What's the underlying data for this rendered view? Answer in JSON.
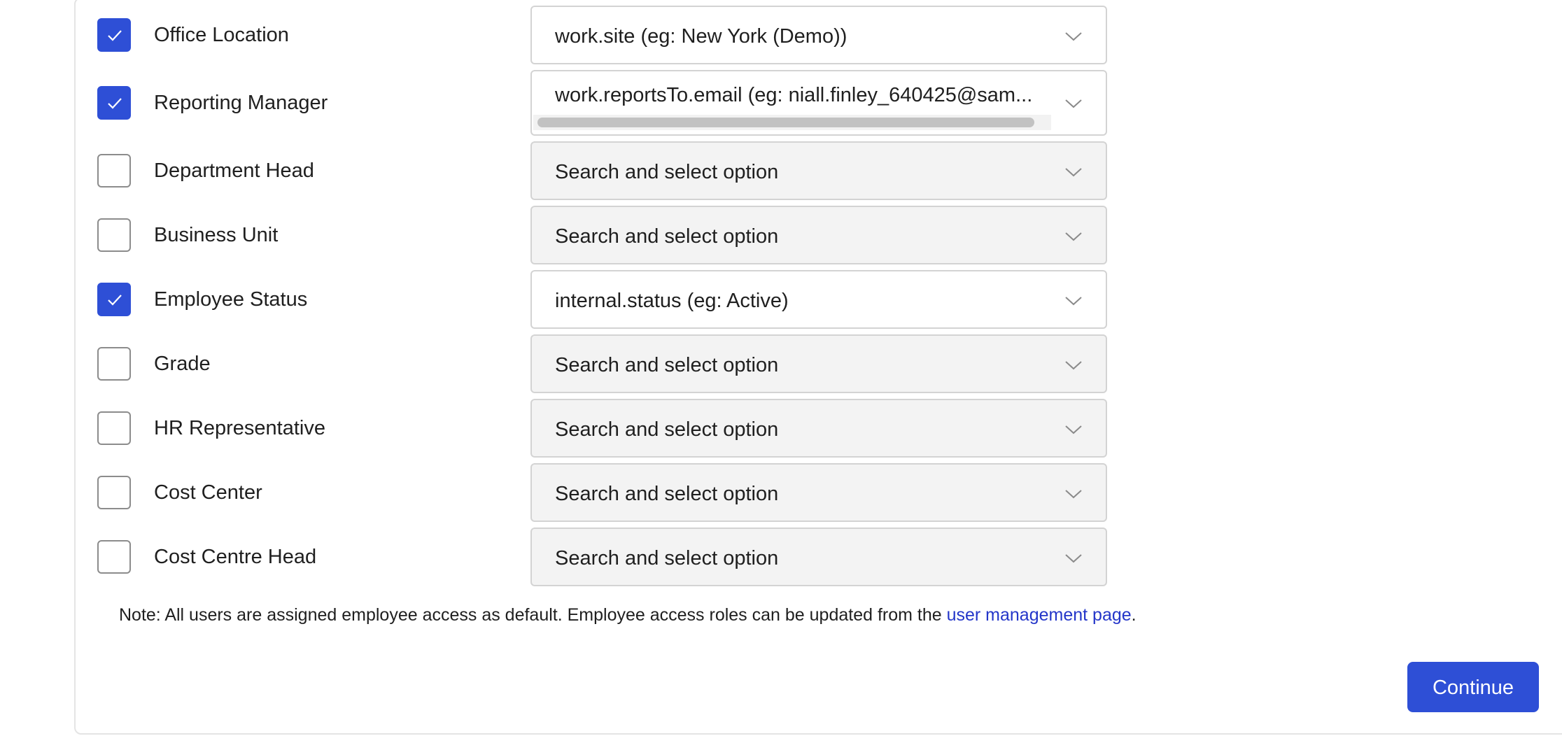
{
  "fields": [
    {
      "label": "Office Location",
      "checked": true,
      "value": "work.site (eg: New York (Demo))",
      "is_placeholder": false
    },
    {
      "label": "Reporting Manager",
      "checked": true,
      "value": "work.reportsTo.email (eg: niall.finley_640425@sam...",
      "is_placeholder": false
    },
    {
      "label": "Department Head",
      "checked": false,
      "value": "Search and select option",
      "is_placeholder": true
    },
    {
      "label": "Business Unit",
      "checked": false,
      "value": "Search and select option",
      "is_placeholder": true
    },
    {
      "label": "Employee Status",
      "checked": true,
      "value": "internal.status (eg: Active)",
      "is_placeholder": false
    },
    {
      "label": "Grade",
      "checked": false,
      "value": "Search and select option",
      "is_placeholder": true
    },
    {
      "label": "HR Representative",
      "checked": false,
      "value": "Search and select option",
      "is_placeholder": true
    },
    {
      "label": "Cost Center",
      "checked": false,
      "value": "Search and select option",
      "is_placeholder": true
    },
    {
      "label": "Cost Centre Head",
      "checked": false,
      "value": "Search and select option",
      "is_placeholder": true
    }
  ],
  "note": {
    "text": "Note: All users are assigned employee access as default. Employee access roles can be updated from the ",
    "link": "user management page",
    "suffix": "."
  },
  "continue_label": "Continue",
  "colors": {
    "accent": "#2e4fd6",
    "link": "#2436c9",
    "placeholder_bg": "#f3f3f3"
  },
  "icons": {
    "checkbox_check": "check-icon",
    "select_arrow": "chevron-down-icon"
  }
}
